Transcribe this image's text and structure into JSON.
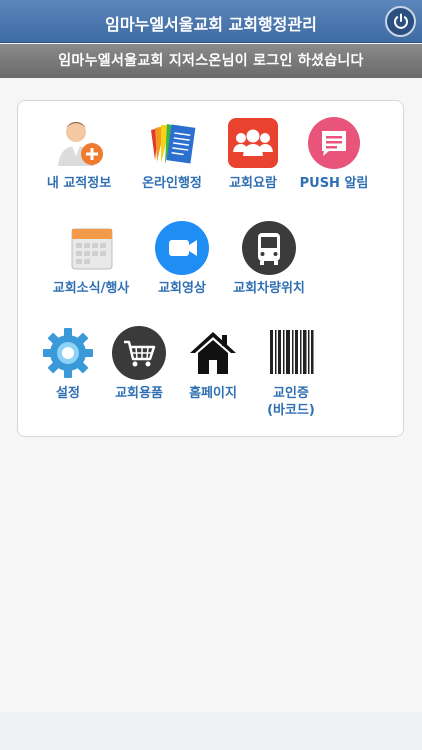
{
  "header": {
    "title": "임마누엘서울교회 교회행정관리"
  },
  "notice": {
    "text": "임마누엘서울교회 지저스온님이 로그인 하셨습니다"
  },
  "menu": [
    {
      "label": "내 교적정보",
      "icon": "user-add-icon"
    },
    {
      "label": "온라인행정",
      "icon": "documents-icon"
    },
    {
      "label": "교회요람",
      "icon": "people-group-icon"
    },
    {
      "label": "PUSH 알림",
      "icon": "message-icon"
    },
    {
      "label": "교회소식/행사",
      "icon": "calendar-icon"
    },
    {
      "label": "교회영상",
      "icon": "video-camera-icon"
    },
    {
      "label": "교회차량위치",
      "icon": "bus-icon"
    },
    {
      "label": "설정",
      "icon": "gear-icon"
    },
    {
      "label": "교회용품",
      "icon": "shopping-cart-icon"
    },
    {
      "label": "홈페이지",
      "icon": "home-icon"
    },
    {
      "label": "교인증\n(바코드)",
      "label_line1": "교인증",
      "label_line2": "(바코드)",
      "icon": "barcode-icon"
    }
  ],
  "colors": {
    "header": "#4a76ad",
    "notice": "#787878",
    "label": "#2f6fb3"
  }
}
